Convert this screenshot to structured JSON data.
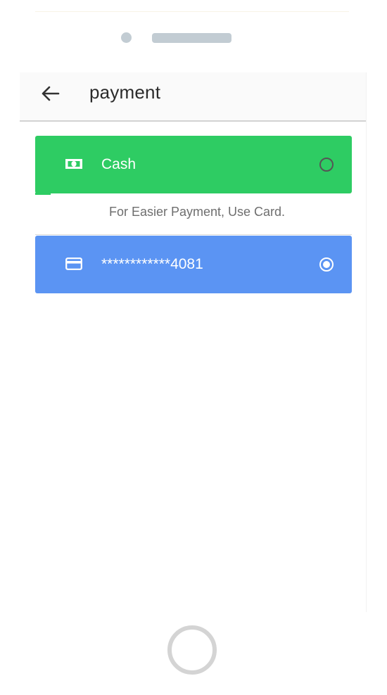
{
  "app_bar": {
    "title": "payment"
  },
  "payment_options": [
    {
      "id": "cash",
      "label": "Cash",
      "icon": "cash-icon",
      "selected": false,
      "color": "#2ecc63"
    },
    {
      "id": "card",
      "label": "************4081",
      "icon": "credit-card-icon",
      "selected": true,
      "color": "#5b94f3"
    }
  ],
  "hint": "For Easier Payment, Use Card."
}
